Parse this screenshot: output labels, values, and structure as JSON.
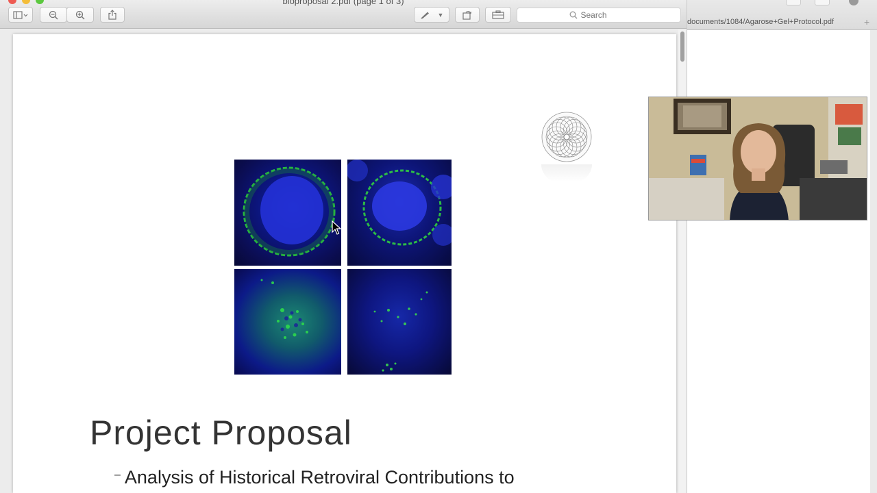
{
  "window": {
    "title": "bioproposal 2.pdf (page 1 of 3)",
    "colors": {
      "close": "#ee5b53",
      "minimize": "#f4bd39",
      "zoom": "#5cc83f"
    }
  },
  "toolbar": {
    "sidebar_icon": "sidebar-icon",
    "zoom_out_icon": "zoom-out-icon",
    "zoom_in_icon": "zoom-in-icon",
    "share_icon": "share-icon",
    "markup_icon": "pen-icon",
    "rotate_icon": "rotate-icon",
    "toolbox_icon": "toolbox-icon",
    "search_placeholder": "Search"
  },
  "slide": {
    "title": "Project Proposal",
    "subtitle_bullet": "–",
    "subtitle": "Analysis of Historical Retroviral Contributions to"
  },
  "browser": {
    "url": "documents/1084/Agarose+Gel+Protocol.pdf",
    "new_tab": "+"
  }
}
